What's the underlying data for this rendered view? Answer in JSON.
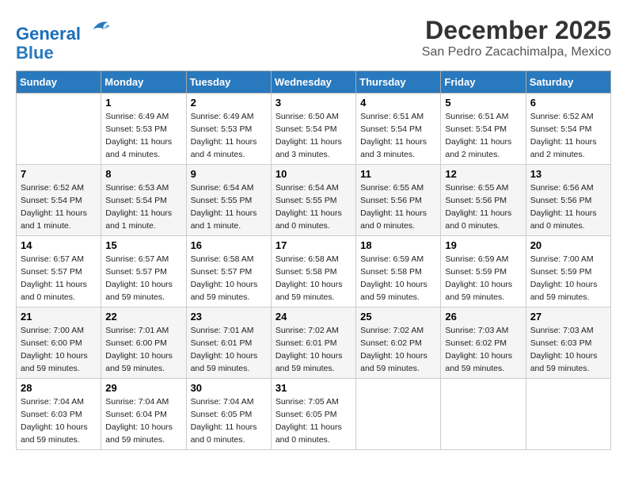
{
  "logo": {
    "line1": "General",
    "line2": "Blue"
  },
  "title": "December 2025",
  "location": "San Pedro Zacachimalpa, Mexico",
  "days_header": [
    "Sunday",
    "Monday",
    "Tuesday",
    "Wednesday",
    "Thursday",
    "Friday",
    "Saturday"
  ],
  "weeks": [
    [
      {
        "num": "",
        "info": ""
      },
      {
        "num": "1",
        "info": "Sunrise: 6:49 AM\nSunset: 5:53 PM\nDaylight: 11 hours\nand 4 minutes."
      },
      {
        "num": "2",
        "info": "Sunrise: 6:49 AM\nSunset: 5:53 PM\nDaylight: 11 hours\nand 4 minutes."
      },
      {
        "num": "3",
        "info": "Sunrise: 6:50 AM\nSunset: 5:54 PM\nDaylight: 11 hours\nand 3 minutes."
      },
      {
        "num": "4",
        "info": "Sunrise: 6:51 AM\nSunset: 5:54 PM\nDaylight: 11 hours\nand 3 minutes."
      },
      {
        "num": "5",
        "info": "Sunrise: 6:51 AM\nSunset: 5:54 PM\nDaylight: 11 hours\nand 2 minutes."
      },
      {
        "num": "6",
        "info": "Sunrise: 6:52 AM\nSunset: 5:54 PM\nDaylight: 11 hours\nand 2 minutes."
      }
    ],
    [
      {
        "num": "7",
        "info": "Sunrise: 6:52 AM\nSunset: 5:54 PM\nDaylight: 11 hours\nand 1 minute."
      },
      {
        "num": "8",
        "info": "Sunrise: 6:53 AM\nSunset: 5:54 PM\nDaylight: 11 hours\nand 1 minute."
      },
      {
        "num": "9",
        "info": "Sunrise: 6:54 AM\nSunset: 5:55 PM\nDaylight: 11 hours\nand 1 minute."
      },
      {
        "num": "10",
        "info": "Sunrise: 6:54 AM\nSunset: 5:55 PM\nDaylight: 11 hours\nand 0 minutes."
      },
      {
        "num": "11",
        "info": "Sunrise: 6:55 AM\nSunset: 5:56 PM\nDaylight: 11 hours\nand 0 minutes."
      },
      {
        "num": "12",
        "info": "Sunrise: 6:55 AM\nSunset: 5:56 PM\nDaylight: 11 hours\nand 0 minutes."
      },
      {
        "num": "13",
        "info": "Sunrise: 6:56 AM\nSunset: 5:56 PM\nDaylight: 11 hours\nand 0 minutes."
      }
    ],
    [
      {
        "num": "14",
        "info": "Sunrise: 6:57 AM\nSunset: 5:57 PM\nDaylight: 11 hours\nand 0 minutes."
      },
      {
        "num": "15",
        "info": "Sunrise: 6:57 AM\nSunset: 5:57 PM\nDaylight: 10 hours\nand 59 minutes."
      },
      {
        "num": "16",
        "info": "Sunrise: 6:58 AM\nSunset: 5:57 PM\nDaylight: 10 hours\nand 59 minutes."
      },
      {
        "num": "17",
        "info": "Sunrise: 6:58 AM\nSunset: 5:58 PM\nDaylight: 10 hours\nand 59 minutes."
      },
      {
        "num": "18",
        "info": "Sunrise: 6:59 AM\nSunset: 5:58 PM\nDaylight: 10 hours\nand 59 minutes."
      },
      {
        "num": "19",
        "info": "Sunrise: 6:59 AM\nSunset: 5:59 PM\nDaylight: 10 hours\nand 59 minutes."
      },
      {
        "num": "20",
        "info": "Sunrise: 7:00 AM\nSunset: 5:59 PM\nDaylight: 10 hours\nand 59 minutes."
      }
    ],
    [
      {
        "num": "21",
        "info": "Sunrise: 7:00 AM\nSunset: 6:00 PM\nDaylight: 10 hours\nand 59 minutes."
      },
      {
        "num": "22",
        "info": "Sunrise: 7:01 AM\nSunset: 6:00 PM\nDaylight: 10 hours\nand 59 minutes."
      },
      {
        "num": "23",
        "info": "Sunrise: 7:01 AM\nSunset: 6:01 PM\nDaylight: 10 hours\nand 59 minutes."
      },
      {
        "num": "24",
        "info": "Sunrise: 7:02 AM\nSunset: 6:01 PM\nDaylight: 10 hours\nand 59 minutes."
      },
      {
        "num": "25",
        "info": "Sunrise: 7:02 AM\nSunset: 6:02 PM\nDaylight: 10 hours\nand 59 minutes."
      },
      {
        "num": "26",
        "info": "Sunrise: 7:03 AM\nSunset: 6:02 PM\nDaylight: 10 hours\nand 59 minutes."
      },
      {
        "num": "27",
        "info": "Sunrise: 7:03 AM\nSunset: 6:03 PM\nDaylight: 10 hours\nand 59 minutes."
      }
    ],
    [
      {
        "num": "28",
        "info": "Sunrise: 7:04 AM\nSunset: 6:03 PM\nDaylight: 10 hours\nand 59 minutes."
      },
      {
        "num": "29",
        "info": "Sunrise: 7:04 AM\nSunset: 6:04 PM\nDaylight: 10 hours\nand 59 minutes."
      },
      {
        "num": "30",
        "info": "Sunrise: 7:04 AM\nSunset: 6:05 PM\nDaylight: 11 hours\nand 0 minutes."
      },
      {
        "num": "31",
        "info": "Sunrise: 7:05 AM\nSunset: 6:05 PM\nDaylight: 11 hours\nand 0 minutes."
      },
      {
        "num": "",
        "info": ""
      },
      {
        "num": "",
        "info": ""
      },
      {
        "num": "",
        "info": ""
      }
    ]
  ]
}
